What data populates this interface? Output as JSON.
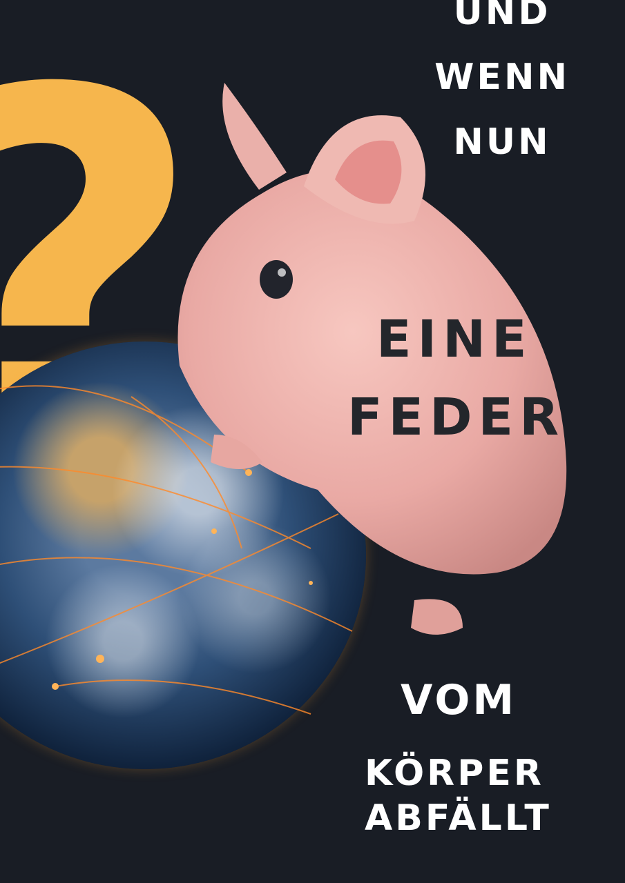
{
  "headline_top": [
    "UND",
    "WENN",
    "NUN"
  ],
  "headline_mid": [
    "EINE",
    "FEDER"
  ],
  "headline_bottom": [
    "VOM",
    "KÖRPER",
    "ABFÄLLT"
  ],
  "colors": {
    "background": "#191d25",
    "question_mark": "#f6b64d",
    "light_text": "#ffffff",
    "dark_text": "#23262b"
  }
}
